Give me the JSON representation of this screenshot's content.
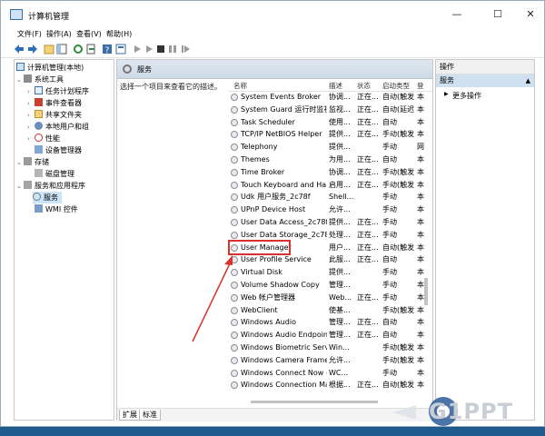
{
  "titlebar": {
    "title": "计算机管理",
    "minimize": "—",
    "maximize": "☐",
    "close": "✕"
  },
  "menubar": {
    "items": [
      "文件(F)",
      "操作(A)",
      "查看(V)",
      "帮助(H)"
    ]
  },
  "tree": {
    "root": "计算机管理(本地)",
    "system_tools": "系统工具",
    "task_scheduler": "任务计划程序",
    "event_viewer": "事件查看器",
    "shared_folders": "共享文件夹",
    "local_users": "本地用户和组",
    "performance": "性能",
    "device_manager": "设备管理器",
    "storage": "存储",
    "disk_management": "磁盘管理",
    "services_apps": "服务和应用程序",
    "services": "服务",
    "wmi": "WMI 控件"
  },
  "center": {
    "header": "服务",
    "description": "选择一个项目来查看它的描述。",
    "columns": [
      "名称",
      "描述",
      "状态",
      "启动类型",
      "登"
    ],
    "rows": [
      [
        "System Events Broker",
        "协调...",
        "正在...",
        "自动(触发...",
        "本"
      ],
      [
        "System Guard 运行时监视...",
        "监视...",
        "正在...",
        "自动(延迟...",
        "本"
      ],
      [
        "Task Scheduler",
        "使用...",
        "正在...",
        "自动",
        "本"
      ],
      [
        "TCP/IP NetBIOS Helper",
        "提供...",
        "正在...",
        "手动(触发...",
        "本"
      ],
      [
        "Telephony",
        "提供...",
        "",
        "手动",
        "网"
      ],
      [
        "Themes",
        "为用...",
        "正在...",
        "自动",
        "本"
      ],
      [
        "Time Broker",
        "协调...",
        "正在...",
        "手动(触发...",
        "本"
      ],
      [
        "Touch Keyboard and Ha...",
        "启用...",
        "正在...",
        "手动(触发...",
        "本"
      ],
      [
        "Udk 用户服务_2c78f",
        "Shell...",
        "",
        "手动",
        "本"
      ],
      [
        "UPnP Device Host",
        "允许...",
        "",
        "手动",
        "本"
      ],
      [
        "User Data Access_2c78f",
        "提供...",
        "正在...",
        "手动",
        "本"
      ],
      [
        "User Data Storage_2c78f",
        "处理...",
        "正在...",
        "手动",
        "本"
      ],
      [
        "User Manager",
        "用户...",
        "正在...",
        "自动(触发...",
        "本"
      ],
      [
        "User Profile Service",
        "此服...",
        "正在...",
        "自动",
        "本"
      ],
      [
        "Virtual Disk",
        "提供...",
        "",
        "手动",
        "本"
      ],
      [
        "Volume Shadow Copy",
        "管理...",
        "",
        "手动",
        "本"
      ],
      [
        "Web 帐户管理器",
        "Web...",
        "正在...",
        "手动",
        "本"
      ],
      [
        "WebClient",
        "使基...",
        "",
        "手动(触发...",
        "本"
      ],
      [
        "Windows Audio",
        "管理...",
        "正在...",
        "自动",
        "本"
      ],
      [
        "Windows Audio Endpoint...",
        "管理...",
        "正在...",
        "自动",
        "本"
      ],
      [
        "Windows Biometric Servi...",
        "Win...",
        "",
        "手动(触发...",
        "本"
      ],
      [
        "Windows Camera Frame ...",
        "允许...",
        "",
        "手动(触发...",
        "本"
      ],
      [
        "Windows Connect Now -...",
        "WC...",
        "",
        "手动",
        "本"
      ],
      [
        "Windows Connection Ma...",
        "根据...",
        "正在...",
        "自动(触发...",
        "本"
      ]
    ],
    "tabs": [
      "扩展",
      "标准"
    ]
  },
  "actions": {
    "header": "操作",
    "section": "服务",
    "more": "更多操作"
  },
  "watermark": {
    "text": "G1PPT"
  },
  "colors": {
    "highlight": "#d9322e",
    "selection": "#cce4f7",
    "section": "#cfe0f1"
  }
}
